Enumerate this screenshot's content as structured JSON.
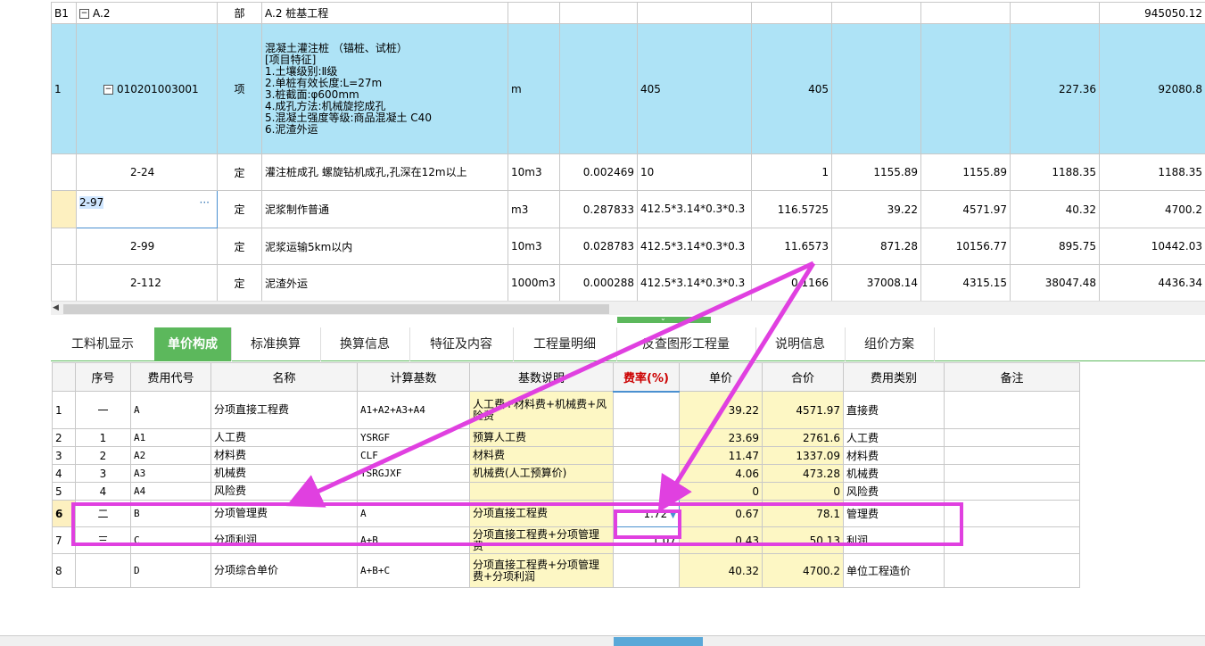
{
  "top_grid": {
    "rows": [
      {
        "seq": "B1",
        "code": "A.2",
        "type": "部",
        "name": "A.2  桩基工程",
        "unit": "",
        "qty_factor": "",
        "expr": "",
        "qty": "",
        "price": "",
        "total": "",
        "price2": "",
        "total2": "945050.12"
      },
      {
        "seq": "1",
        "code": "010201003001",
        "type": "项",
        "name": "混凝土灌注桩 （锚桩、试桩）\n[项目特征]\n1.土壤级别:Ⅱ级\n2.单桩有效长度:L=27m\n3.桩截面:φ600mm\n4.成孔方法:机械旋挖成孔\n5.混凝土强度等级:商品混凝土 C40\n6.泥渣外运",
        "unit": "m",
        "qty_factor": "",
        "expr": "405",
        "qty": "405",
        "price": "",
        "total": "",
        "price2": "227.36",
        "total2": "92080.8"
      },
      {
        "seq": "",
        "code": "2-24",
        "type": "定",
        "name": "灌注桩成孔 螺旋钻机成孔,孔深在12m以上",
        "unit": "10m3",
        "qty_factor": "0.002469",
        "expr": "10",
        "qty": "1",
        "price": "1155.89",
        "total": "1155.89",
        "price2": "1188.35",
        "total2": "1188.35"
      },
      {
        "seq": "",
        "code": "2-97",
        "type": "定",
        "name": "泥浆制作普通",
        "unit": "m3",
        "qty_factor": "0.287833",
        "expr": "412.5*3.14*0.3*0.3",
        "qty": "116.5725",
        "price": "39.22",
        "total": "4571.97",
        "price2": "40.32",
        "total2": "4700.2"
      },
      {
        "seq": "",
        "code": "2-99",
        "type": "定",
        "name": "泥浆运输5km以内",
        "unit": "10m3",
        "qty_factor": "0.028783",
        "expr": "412.5*3.14*0.3*0.3",
        "qty": "11.6573",
        "price": "871.28",
        "total": "10156.77",
        "price2": "895.75",
        "total2": "10442.03"
      },
      {
        "seq": "",
        "code": "2-112",
        "type": "定",
        "name": "泥渣外运",
        "unit": "1000m3",
        "qty_factor": "0.000288",
        "expr": "412.5*3.14*0.3*0.3",
        "qty": "0.1166",
        "price": "37008.14",
        "total": "4315.15",
        "price2": "38047.48",
        "total2": "4436.34"
      }
    ],
    "editing_ellipsis": "···"
  },
  "tabs": [
    {
      "label": "工料机显示"
    },
    {
      "label": "单价构成"
    },
    {
      "label": "标准换算"
    },
    {
      "label": "换算信息"
    },
    {
      "label": "特征及内容"
    },
    {
      "label": "工程量明细"
    },
    {
      "label": "反查图形工程量"
    },
    {
      "label": "说明信息"
    },
    {
      "label": "组价方案"
    }
  ],
  "bottom_grid": {
    "headers": [
      "",
      "序号",
      "费用代号",
      "名称",
      "计算基数",
      "基数说明",
      "费率(%)",
      "单价",
      "合价",
      "费用类别",
      "备注"
    ],
    "rows": [
      {
        "row": "1",
        "seq": "一",
        "code": "A",
        "name": "分项直接工程费",
        "base": "A1+A2+A3+A4",
        "desc": "人工费+材料费+机械费+风险费",
        "rate": "",
        "price": "39.22",
        "total": "4571.97",
        "cat": "直接费",
        "note": ""
      },
      {
        "row": "2",
        "seq": "1",
        "code": "A1",
        "name": "人工费",
        "base": "YSRGF",
        "desc": "预算人工费",
        "rate": "",
        "price": "23.69",
        "total": "2761.6",
        "cat": "人工费",
        "note": ""
      },
      {
        "row": "3",
        "seq": "2",
        "code": "A2",
        "name": "材料费",
        "base": "CLF",
        "desc": "材料费",
        "rate": "",
        "price": "11.47",
        "total": "1337.09",
        "cat": "材料费",
        "note": ""
      },
      {
        "row": "4",
        "seq": "3",
        "code": "A3",
        "name": "机械费",
        "base": "YSRGJXF",
        "desc": "机械费(人工预算价)",
        "rate": "",
        "price": "4.06",
        "total": "473.28",
        "cat": "机械费",
        "note": ""
      },
      {
        "row": "5",
        "seq": "4",
        "code": "A4",
        "name": "风险费",
        "base": "",
        "desc": "",
        "rate": "",
        "price": "0",
        "total": "0",
        "cat": "风险费",
        "note": ""
      },
      {
        "row": "6",
        "seq": "二",
        "code": "B",
        "name": "分项管理费",
        "base": "A",
        "desc": "分项直接工程费",
        "rate": "1.72",
        "price": "0.67",
        "total": "78.1",
        "cat": "管理费",
        "note": ""
      },
      {
        "row": "7",
        "seq": "三",
        "code": "C",
        "name": "分项利润",
        "base": "A+B",
        "desc": "分项直接工程费+分项管理费",
        "rate": "1.07",
        "price": "0.43",
        "total": "50.13",
        "cat": "利润",
        "note": ""
      },
      {
        "row": "8",
        "seq": "",
        "code": "D",
        "name": "分项综合单价",
        "base": "A+B+C",
        "desc": "分项直接工程费+分项管理费+分项利润",
        "rate": "",
        "price": "40.32",
        "total": "4700.2",
        "cat": "单位工程造价",
        "note": ""
      }
    ]
  },
  "colors": {
    "accent_green": "#5cb85c",
    "selected_blue": "#aee3f6",
    "annotation": "#e040e0",
    "yellow_cell": "#fdf7c4"
  }
}
